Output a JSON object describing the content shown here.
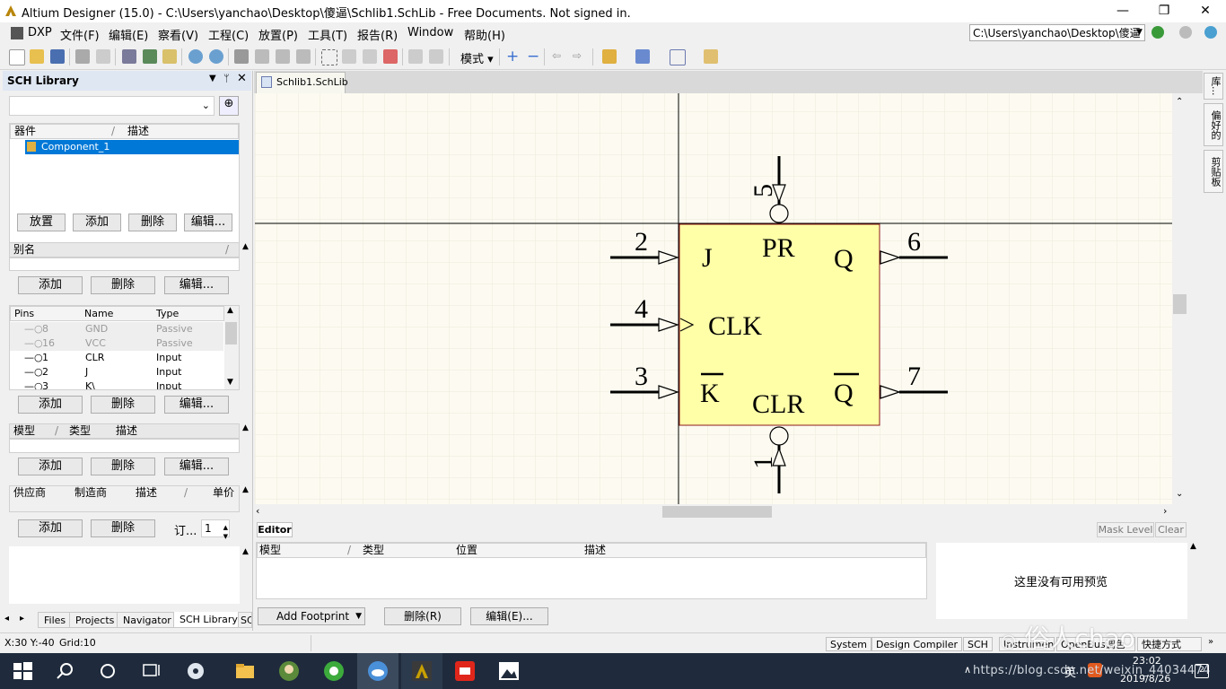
{
  "window": {
    "title": "Altium Designer (15.0) - C:\\Users\\yanchao\\Desktop\\傻逼\\Schlib1.SchLib - Free Documents. Not signed in."
  },
  "menu": {
    "items": [
      "DXP",
      "文件(F)",
      "编辑(E)",
      "察看(V)",
      "工程(C)",
      "放置(P)",
      "工具(T)",
      "报告(R)",
      "Window",
      "帮助(H)"
    ],
    "path": "C:\\Users\\yanchao\\Desktop\\傻逼"
  },
  "toolbar": {
    "mode_label": "模式"
  },
  "panel": {
    "title": "SCH Library",
    "component_headers": {
      "name": "器件",
      "desc": "描述"
    },
    "components": [
      "Component_1"
    ],
    "buttons_top": [
      "放置",
      "添加",
      "删除",
      "编辑..."
    ],
    "alias_header": "别名",
    "buttons_alias": [
      "添加",
      "删除",
      "编辑..."
    ],
    "pins_headers": {
      "pins": "Pins",
      "name": "Name",
      "type": "Type"
    },
    "pins": [
      {
        "num": "8",
        "name": "GND",
        "type": "Passive"
      },
      {
        "num": "16",
        "name": "VCC",
        "type": "Passive"
      },
      {
        "num": "1",
        "name": "CLR",
        "type": "Input"
      },
      {
        "num": "2",
        "name": "J",
        "type": "Input"
      },
      {
        "num": "3",
        "name": "K\\",
        "type": "Input"
      }
    ],
    "buttons_pins": [
      "添加",
      "删除",
      "编辑..."
    ],
    "model_headers": {
      "model": "模型",
      "type": "类型",
      "desc": "描述"
    },
    "buttons_model": [
      "添加",
      "删除",
      "编辑..."
    ],
    "supplier_headers": {
      "supplier": "供应商",
      "maker": "制造商",
      "desc": "描述",
      "price": "单价"
    },
    "buttons_supplier": [
      "添加",
      "删除"
    ],
    "order_label": "订...",
    "order_value": "1",
    "bottom_tabs": [
      "Files",
      "Projects",
      "Navigator",
      "SCH Library",
      "SC"
    ]
  },
  "document": {
    "tab": "Schlib1.SchLib"
  },
  "symbol": {
    "pr": "PR",
    "j": "J",
    "q": "Q",
    "clk": "CLK",
    "k": "K",
    "clr": "CLR",
    "qbar": "Q",
    "pin_nums": {
      "pr": "5",
      "j": "2",
      "clk": "4",
      "k": "3",
      "q": "6",
      "qbar": "7",
      "clr": "1"
    }
  },
  "editor": {
    "tab": "Editor",
    "mask_level": "Mask Level",
    "clear": "Clear",
    "headers": {
      "model": "模型",
      "type": "类型",
      "position": "位置",
      "desc": "描述"
    },
    "add_footprint": "Add Footprint",
    "delete": "删除(R)",
    "edit": "编辑(E)...",
    "preview_text": "这里没有可用预览"
  },
  "right_tabs": [
    "库...",
    "偏好的",
    "剪贴板"
  ],
  "status": {
    "coords": "X:30 Y:-40",
    "grid": "Grid:10",
    "tabs": [
      "System",
      "Design Compiler",
      "SCH",
      "Instruments",
      "OpenBus调色板",
      "快捷方式"
    ]
  },
  "taskbar": {
    "time": "23:02",
    "date": "2019/8/26",
    "ime": "英",
    "watermark_url": "https://blog.csdn.net/weixin_44034474",
    "watermark_brand": "俗人chao"
  },
  "colors": {
    "body_fill": "#ffffa8",
    "body_border": "#8b1a1a",
    "canvas_bg": "#fdfbf1",
    "selection": "#0078d7"
  }
}
